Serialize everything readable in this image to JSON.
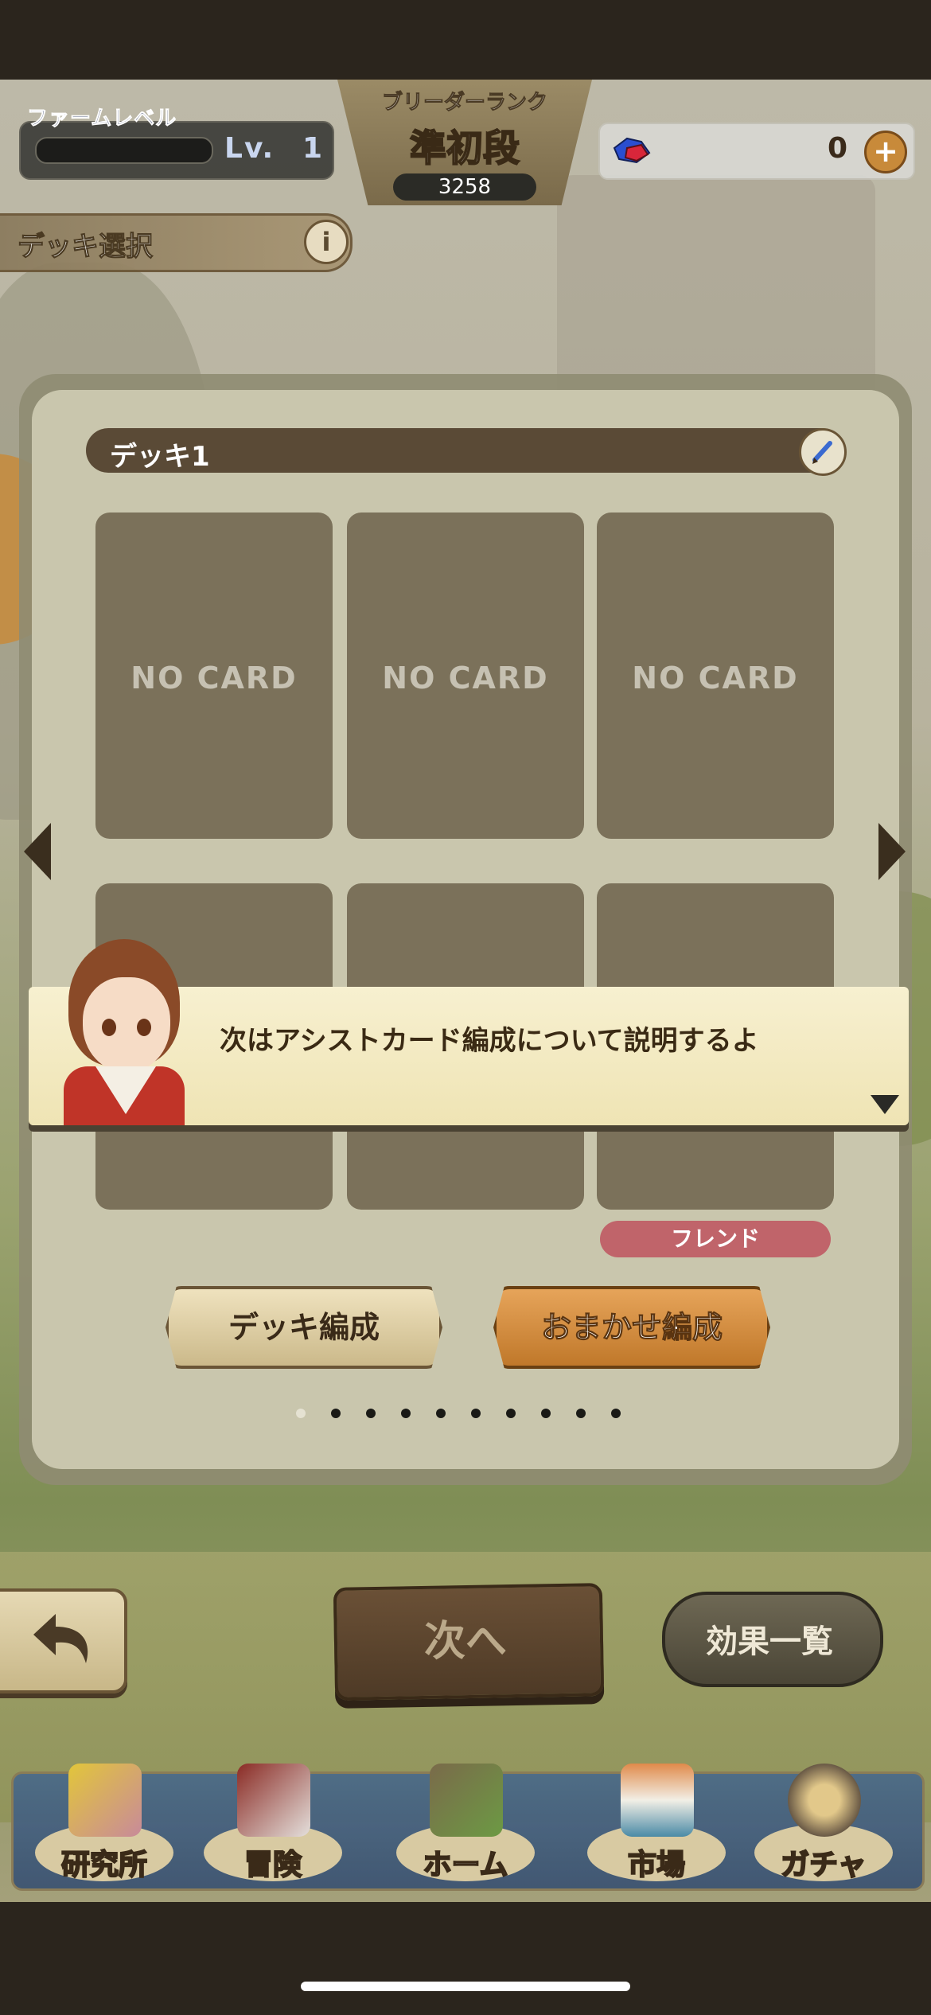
{
  "header": {
    "farm_level_label": "ファームレベル",
    "farm_level_prefix": "Lv.",
    "farm_level_value": "1",
    "breeder_rank_label": "ブリーダーランク",
    "breeder_rank_name": "準初段",
    "breeder_rank_score": "3258",
    "gem_count": "0",
    "gem_plus_label": "+"
  },
  "deck_select": {
    "title": "デッキ選択",
    "info_label": "i"
  },
  "deck": {
    "name": "デッキ1",
    "slots": [
      "NO CARD",
      "NO CARD",
      "NO CARD",
      "",
      "",
      ""
    ],
    "friend_badge": "フレンド",
    "edit_button": "デッキ編成",
    "auto_button": "おまかせ編成",
    "page_count": 10,
    "active_page": 0
  },
  "dialog": {
    "text": "次はアシストカード編成について説明するよ"
  },
  "actions": {
    "next_label": "次へ",
    "effects_label": "効果一覧"
  },
  "nav": {
    "items": [
      {
        "label": "研究所",
        "icon": "laboratory-icon"
      },
      {
        "label": "冒険",
        "icon": "adventure-book-icon"
      },
      {
        "label": "ホーム",
        "icon": "home-windmill-icon"
      },
      {
        "label": "市場",
        "icon": "market-stall-icon"
      },
      {
        "label": "ガチャ",
        "icon": "gacha-machine-icon"
      }
    ]
  },
  "colors": {
    "panel": "#c9c6ad",
    "card_slot": "#7b715a",
    "friend_badge": "#c0646a",
    "auto_button": "#d08a3a",
    "nav_bar": "#3f5a7a"
  }
}
